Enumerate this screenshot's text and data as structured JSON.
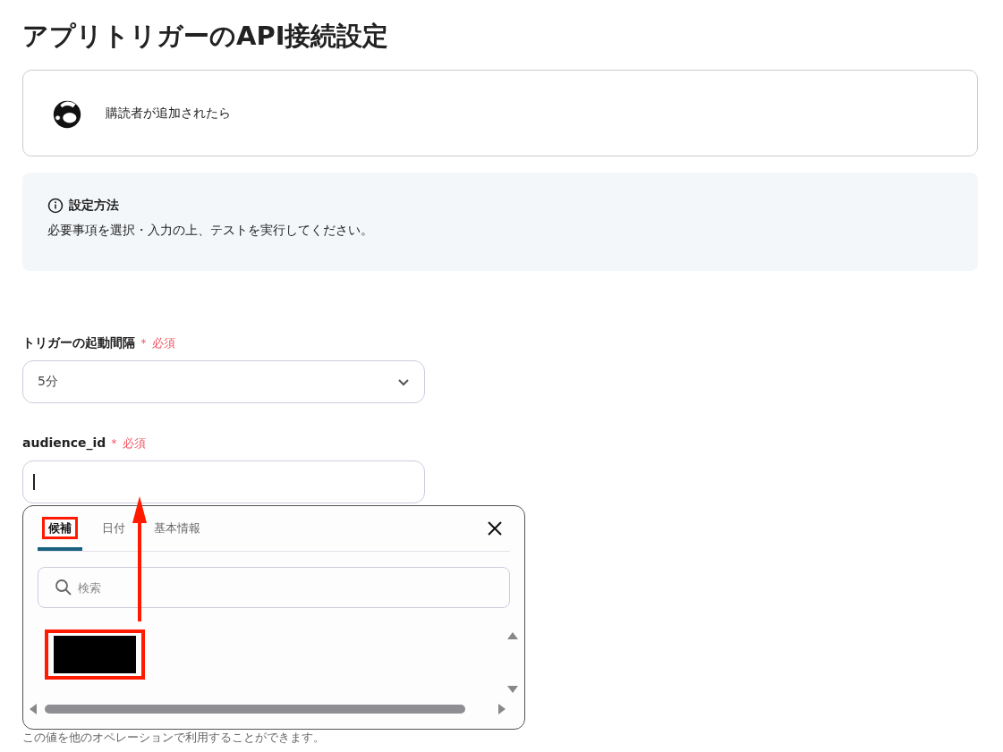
{
  "page_title": "アプリトリガーのAPI接続設定",
  "trigger_card": {
    "label": "購読者が追加されたら"
  },
  "info_box": {
    "heading": "設定方法",
    "text": "必要事項を選択・入力の上、テストを実行してください。"
  },
  "fields": [
    {
      "kind": "select",
      "label": "トリガーの起動間隔",
      "required_mark": "＊",
      "required_label": "必須",
      "value": "5分"
    },
    {
      "kind": "text",
      "label": "audience_id",
      "required_mark": "＊",
      "required_label": "必須",
      "focused": true,
      "hint": "この値を他のオペレーションで利用することができます。"
    }
  ],
  "popup": {
    "tabs": [
      {
        "label": "候補",
        "selected": true,
        "highlighted": true
      },
      {
        "label": "日付",
        "selected": false,
        "highlighted": false
      },
      {
        "label": "基本情報",
        "selected": false,
        "highlighted": false
      }
    ],
    "search": {
      "placeholder": "検索"
    },
    "items": [
      {
        "kind": "redacted",
        "highlighted": true
      }
    ]
  }
}
